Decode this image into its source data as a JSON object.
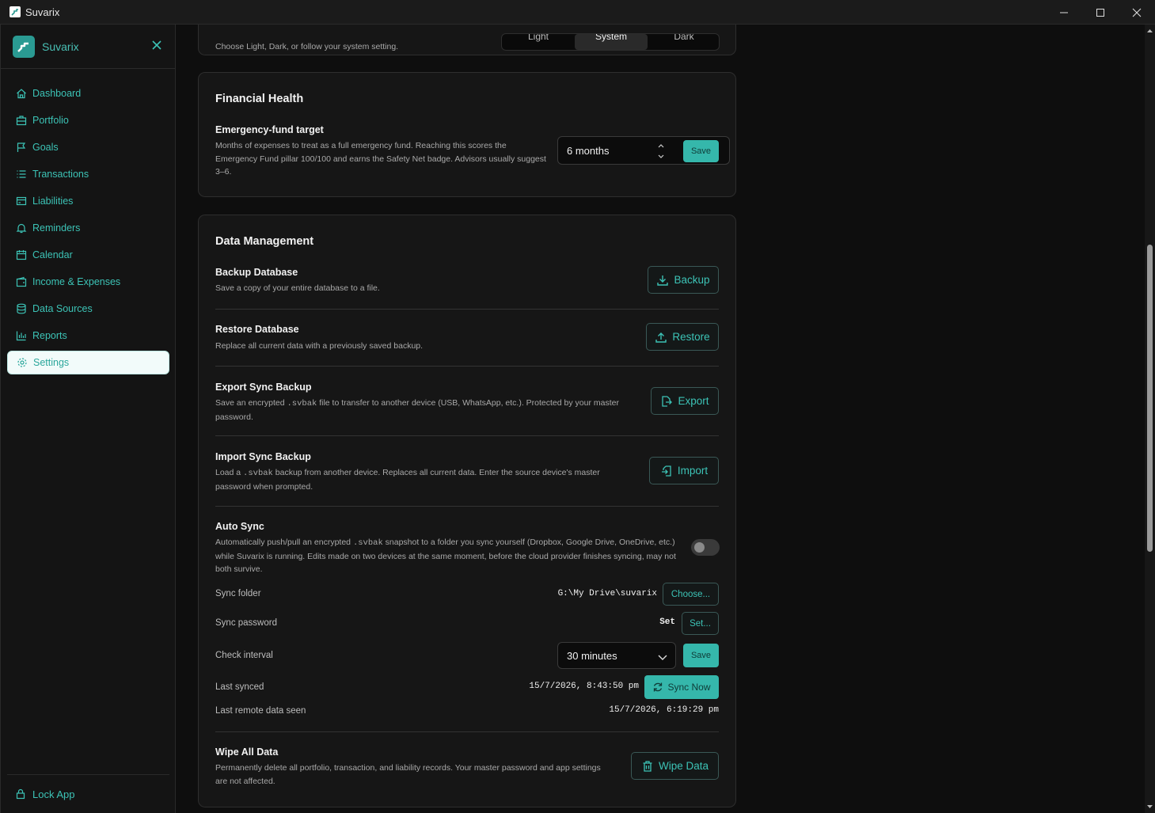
{
  "window": {
    "title": "Suvarix"
  },
  "sidebar": {
    "brand": "Suvarix",
    "items": [
      {
        "label": "Dashboard",
        "icon": "home-icon"
      },
      {
        "label": "Portfolio",
        "icon": "briefcase-icon"
      },
      {
        "label": "Goals",
        "icon": "flag-icon"
      },
      {
        "label": "Transactions",
        "icon": "list-icon"
      },
      {
        "label": "Liabilities",
        "icon": "card-icon"
      },
      {
        "label": "Reminders",
        "icon": "bell-icon"
      },
      {
        "label": "Calendar",
        "icon": "calendar-icon"
      },
      {
        "label": "Income & Expenses",
        "icon": "wallet-icon"
      },
      {
        "label": "Data Sources",
        "icon": "database-icon"
      },
      {
        "label": "Reports",
        "icon": "bar-chart-icon"
      },
      {
        "label": "Settings",
        "icon": "gear-icon",
        "active": true
      }
    ],
    "lock_label": "Lock App"
  },
  "appearance": {
    "desc": "Choose Light, Dark, or follow your system setting.",
    "options": [
      "Light",
      "System",
      "Dark"
    ],
    "selected": "System"
  },
  "financial": {
    "title": "Financial Health",
    "emergency_title": "Emergency-fund target",
    "emergency_desc": "Months of expenses to treat as a full emergency fund. Reaching this scores the Emergency Fund pillar 100/100 and earns the Safety Net badge. Advisors usually suggest 3–6.",
    "emergency_value": "6 months",
    "save_label": "Save"
  },
  "data_mgmt": {
    "title": "Data Management",
    "backup": {
      "title": "Backup Database",
      "desc": "Save a copy of your entire database to a file.",
      "button": "Backup"
    },
    "restore": {
      "title": "Restore Database",
      "desc": "Replace all current data with a previously saved backup.",
      "button": "Restore"
    },
    "export": {
      "title": "Export Sync Backup",
      "desc_a": "Save an encrypted ",
      "ext": ".svbak",
      "desc_b": " file to transfer to another device (USB, WhatsApp, etc.). Protected by your master password.",
      "button": "Export"
    },
    "import": {
      "title": "Import Sync Backup",
      "desc_a": "Load a ",
      "ext": ".svbak",
      "desc_b": " backup from another device. Replaces all current data. Enter the source device's master password when prompted.",
      "button": "Import"
    },
    "autosync": {
      "title": "Auto Sync",
      "desc_a": "Automatically push/pull an encrypted ",
      "ext": ".svbak",
      "desc_b": " snapshot to a folder you sync yourself (Dropbox, Google Drive, OneDrive, etc.) while Suvarix is running. Edits made on two devices at the same moment, before the cloud provider finishes syncing, may not both survive.",
      "enabled": false,
      "folder_label": "Sync folder",
      "folder_value": "G:\\My Drive\\suvarix",
      "folder_button": "Choose...",
      "password_label": "Sync password",
      "password_value": "Set",
      "password_button": "Set...",
      "interval_label": "Check interval",
      "interval_value": "30 minutes",
      "interval_save": "Save",
      "last_synced_label": "Last synced",
      "last_synced_value": "15/7/2026, 8:43:50 pm",
      "sync_now": "Sync Now",
      "last_remote_label": "Last remote data seen",
      "last_remote_value": "15/7/2026, 6:19:29 pm"
    },
    "wipe": {
      "title": "Wipe All Data",
      "desc": "Permanently delete all portfolio, transaction, and liability records. Your master password and app settings are not affected.",
      "button": "Wipe Data"
    }
  }
}
